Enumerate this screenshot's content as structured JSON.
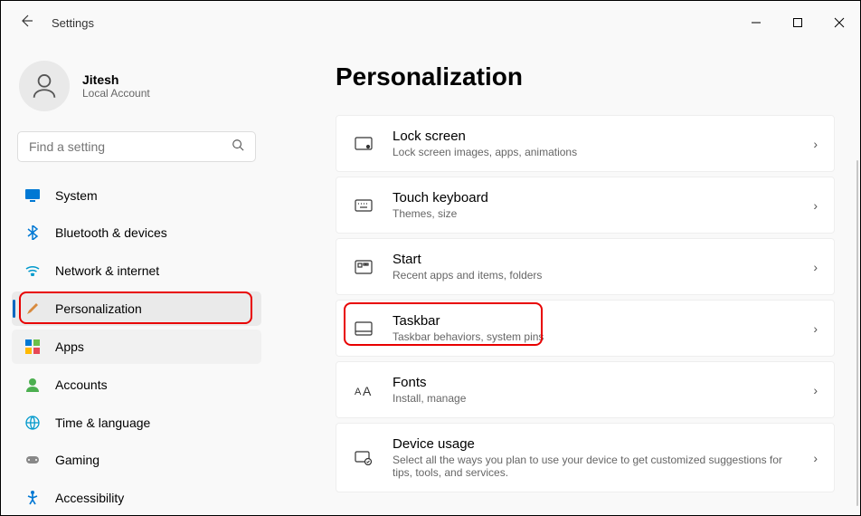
{
  "titlebar": {
    "title": "Settings"
  },
  "user": {
    "name": "Jitesh",
    "account_type": "Local Account"
  },
  "search": {
    "placeholder": "Find a setting"
  },
  "nav": {
    "system": "System",
    "bluetooth": "Bluetooth & devices",
    "network": "Network & internet",
    "personalization": "Personalization",
    "apps": "Apps",
    "accounts": "Accounts",
    "time_language": "Time & language",
    "gaming": "Gaming",
    "accessibility": "Accessibility"
  },
  "main": {
    "title": "Personalization",
    "cards": {
      "lock_screen": {
        "title": "Lock screen",
        "subtitle": "Lock screen images, apps, animations"
      },
      "touch_keyboard": {
        "title": "Touch keyboard",
        "subtitle": "Themes, size"
      },
      "start": {
        "title": "Start",
        "subtitle": "Recent apps and items, folders"
      },
      "taskbar": {
        "title": "Taskbar",
        "subtitle": "Taskbar behaviors, system pins"
      },
      "fonts": {
        "title": "Fonts",
        "subtitle": "Install, manage"
      },
      "device_usage": {
        "title": "Device usage",
        "subtitle": "Select all the ways you plan to use your device to get customized suggestions for tips, tools, and services."
      }
    }
  }
}
